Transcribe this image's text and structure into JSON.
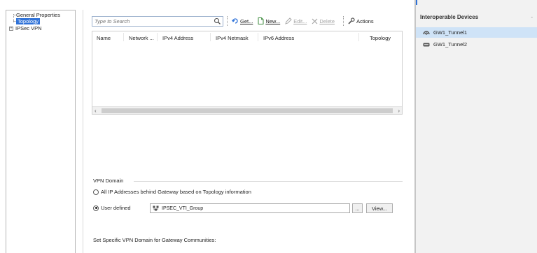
{
  "tree": {
    "items": [
      {
        "label": "General Properties"
      },
      {
        "label": "Topology"
      },
      {
        "label": "IPSec VPN",
        "expander": "+"
      }
    ]
  },
  "toolbar": {
    "search_placeholder": "Type to Search",
    "get_label": "Get...",
    "new_label": "New...",
    "edit_label": "Edit...",
    "delete_label": "Delete",
    "actions_label": "Actions",
    "icons": {
      "search": "magnifier-icon",
      "get": "get-icon",
      "new": "new-document-icon",
      "edit": "edit-icon",
      "delete": "delete-x-icon",
      "actions": "wrench-icon"
    }
  },
  "grid": {
    "columns": [
      "Name",
      "Network ...",
      "IPv4 Address",
      "IPv4 Netmask",
      "IPv6 Address",
      "Topology"
    ],
    "rows": []
  },
  "vpn_domain": {
    "title": "VPN Domain",
    "option_all_label": "All IP Addresses behind Gateway based on Topology information",
    "option_user_label": "User defined",
    "selected": "user_defined",
    "group_value": "IPSEC_VTI_Group",
    "browse_label": "...",
    "view_label": "View...",
    "community_label": "Set Specific VPN Domain for Gateway Communities:"
  },
  "right_panel": {
    "title": "Interoperable Devices",
    "devices": [
      {
        "label": "GW1_Tunnel1",
        "selected": true,
        "icon": "tunnel-icon"
      },
      {
        "label": "GW1_Tunnel2",
        "selected": false,
        "icon": "device-icon"
      }
    ]
  },
  "colors": {
    "selection_blue": "#2f72d8",
    "row_selected": "#cfe3f7",
    "panel_bg": "#f2f2f2"
  }
}
